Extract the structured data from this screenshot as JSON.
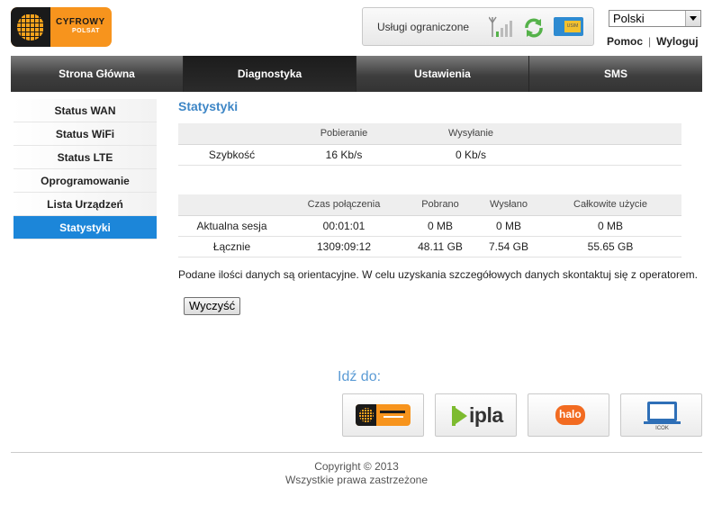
{
  "header": {
    "brand_line1": "CYFROWY",
    "brand_line2": "POLSAT",
    "status_text": "Usługi ograniczone",
    "sim_label": "USIM",
    "language": "Polski",
    "help_link": "Pomoc",
    "logout_link": "Wyloguj"
  },
  "nav": {
    "tabs": [
      "Strona Główna",
      "Diagnostyka",
      "Ustawienia",
      "SMS"
    ],
    "active": "Diagnostyka"
  },
  "sidebar": {
    "items": [
      "Status WAN",
      "Status WiFi",
      "Status LTE",
      "Oprogramowanie",
      "Lista Urządzeń",
      "Statystyki"
    ],
    "active": "Statystyki"
  },
  "content": {
    "title": "Statystyki",
    "speed_table": {
      "headers": [
        "",
        "Pobieranie",
        "Wysyłanie",
        ""
      ],
      "rows": [
        [
          "Szybkość",
          "16 Kb/s",
          "0 Kb/s",
          ""
        ]
      ]
    },
    "usage_table": {
      "headers": [
        "",
        "Czas połączenia",
        "Pobrano",
        "Wysłano",
        "Całkowite użycie"
      ],
      "rows": [
        [
          "Aktualna sesja",
          "00:01:01",
          "0 MB",
          "0 MB",
          "0 MB"
        ],
        [
          "Łącznie",
          "1309:09:12",
          "48.11 GB",
          "7.54 GB",
          "55.65 GB"
        ]
      ]
    },
    "note": "Podane ilości danych są orientacyjne. W celu uzyskania szczegółowych danych skontaktuj się z operatorem.",
    "clear_button": "Wyczyść"
  },
  "goto": {
    "label": "Idź do:",
    "tiles": [
      "Cyfrowy Polsat",
      "ipla",
      "halo",
      "ICOK"
    ],
    "ipla_text": "ipla",
    "halo_text": "halo",
    "icok_text": "ICOK"
  },
  "footer": {
    "copyright": "Copyright © 2013",
    "rights": "Wszystkie prawa zastrzeżone"
  },
  "colors": {
    "accent_blue": "#1c86d9",
    "title_blue": "#3d86c6",
    "brand_orange": "#f7941d"
  }
}
